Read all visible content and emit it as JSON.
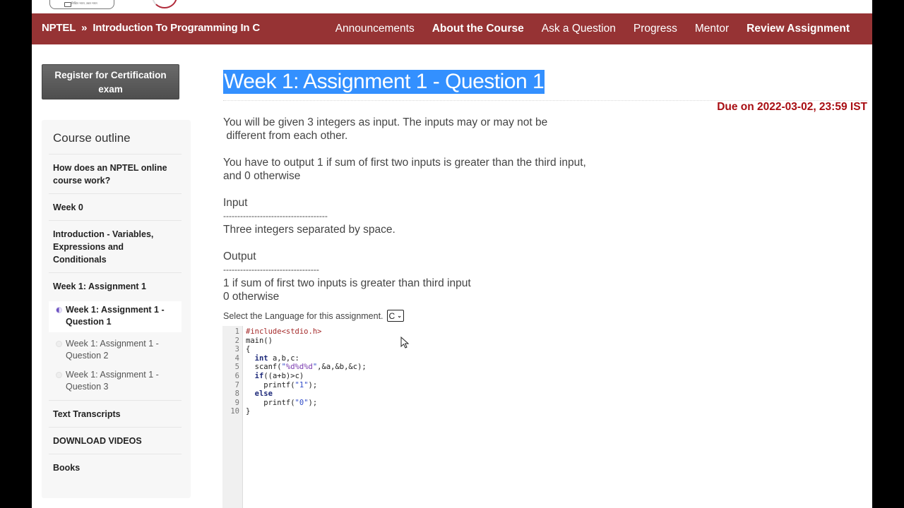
{
  "logo": {
    "tagline": "शिक्षित भारत, उन्नत भारत"
  },
  "navbar": {
    "breadcrumb": {
      "root": "NPTEL",
      "separator": "»",
      "course": "Introduction To Programming In C"
    },
    "links": [
      {
        "label": "Announcements",
        "bold": false
      },
      {
        "label": "About the Course",
        "bold": true
      },
      {
        "label": "Ask a Question",
        "bold": false
      },
      {
        "label": "Progress",
        "bold": false
      },
      {
        "label": "Mentor",
        "bold": false
      },
      {
        "label": "Review Assignment",
        "bold": true
      }
    ]
  },
  "sidebar": {
    "register_button": "Register for Certification exam",
    "outline_title": "Course outline",
    "items": [
      {
        "label": "How does an NPTEL online course work?"
      },
      {
        "label": "Week 0"
      },
      {
        "label": "Introduction - Variables, Expressions and Conditionals"
      },
      {
        "label": "Week 1: Assignment 1"
      }
    ],
    "sub_items": [
      {
        "label": "Week 1: Assignment 1 - Question 1",
        "active": true
      },
      {
        "label": "Week 1: Assignment 1 - Question 2",
        "active": false
      },
      {
        "label": "Week 1: Assignment 1 - Question 3",
        "active": false
      }
    ],
    "bottom_items": [
      {
        "label": "Text Transcripts"
      },
      {
        "label": "DOWNLOAD VIDEOS"
      },
      {
        "label": "Books"
      }
    ]
  },
  "main": {
    "title": "Week 1: Assignment 1 - Question 1",
    "due": "Due on 2022-03-02, 23:59 IST",
    "paragraphs": {
      "p1_line1": "You will be given 3 integers as input. The inputs may or may not be",
      "p1_line2": " different from each other.",
      "p2_line1": "You have to output 1 if sum of first two inputs is greater than the third input,",
      "p2_line2": "and 0 otherwise",
      "input_heading": "Input",
      "input_rule": "-------------------------------------",
      "input_desc": "Three integers separated by space.",
      "output_heading": "Output",
      "output_rule": "----------------------------------",
      "output_line1": "1 if sum of first two inputs is greater than third input",
      "output_line2": "0 otherwise"
    },
    "language_label": "Select the Language for this assignment.",
    "language_selected": "C",
    "code_lines": [
      {
        "n": "1",
        "parts": [
          [
            "pre",
            "#include<stdio.h>"
          ]
        ]
      },
      {
        "n": "2",
        "parts": [
          [
            "txt",
            "main()"
          ]
        ]
      },
      {
        "n": "3",
        "parts": [
          [
            "txt",
            "{"
          ]
        ]
      },
      {
        "n": "4",
        "parts": [
          [
            "txt",
            "  "
          ],
          [
            "kw",
            "int"
          ],
          [
            "txt",
            " a,b,c:"
          ]
        ]
      },
      {
        "n": "5",
        "parts": [
          [
            "txt",
            "  scanf("
          ],
          [
            "str",
            "\""
          ],
          [
            "fmt",
            "%d%d%d"
          ],
          [
            "str",
            "\""
          ],
          [
            "txt",
            ",&a,&b,&c);"
          ]
        ]
      },
      {
        "n": "6",
        "parts": [
          [
            "txt",
            "  "
          ],
          [
            "kw",
            "if"
          ],
          [
            "txt",
            "((a+b)>c)"
          ]
        ]
      },
      {
        "n": "7",
        "parts": [
          [
            "txt",
            "    printf("
          ],
          [
            "str",
            "\"1\""
          ],
          [
            "txt",
            ");"
          ]
        ]
      },
      {
        "n": "8",
        "parts": [
          [
            "txt",
            "  "
          ],
          [
            "kw",
            "else"
          ]
        ]
      },
      {
        "n": "9",
        "parts": [
          [
            "txt",
            "    printf("
          ],
          [
            "str",
            "\"0\""
          ],
          [
            "txt",
            ");"
          ]
        ]
      },
      {
        "n": "10",
        "parts": [
          [
            "txt",
            "}"
          ]
        ]
      }
    ]
  }
}
